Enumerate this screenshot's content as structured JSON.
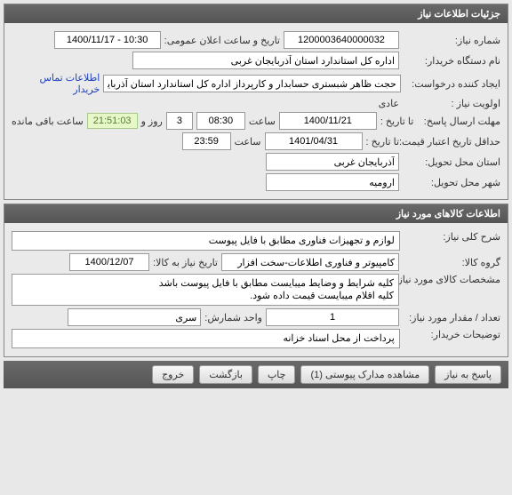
{
  "section1": {
    "title": "جزئیات اطلاعات نیاز",
    "need_number_label": "شماره نیاز:",
    "need_number": "1200003640000032",
    "announce_label": "تاریخ و ساعت اعلان عمومی:",
    "announce_value": "1400/11/17 - 10:30",
    "buyer_label": "نام دستگاه خریدار:",
    "buyer_value": "اداره کل استاندارد استان آذربایجان غربی",
    "requester_label": "ایجاد کننده درخواست:",
    "requester_value": "حجت ظاهر شبستری حسابدار و کارپرداز اداره کل استاندارد استان آذربایجان غربی",
    "contact_link": "اطلاعات تماس خریدار",
    "priority_label": "اولویت نیاز :",
    "priority_value": "عادی",
    "deadline_label": "مهلت ارسال پاسخ:",
    "to_date_label": "تا تاریخ :",
    "deadline_date": "1400/11/21",
    "time_label": "ساعت",
    "deadline_time": "08:30",
    "days_value": "3",
    "days_and": "روز و",
    "countdown": "21:51:03",
    "remaining": "ساعت باقی مانده",
    "validity_label": "حداقل تاریخ اعتبار قیمت:",
    "validity_date": "1401/04/31",
    "validity_time": "23:59",
    "province_label": "استان محل تحویل:",
    "province_value": "آذربایجان غربی",
    "city_label": "شهر محل تحویل:",
    "city_value": "ارومیه"
  },
  "section2": {
    "title": "اطلاعات کالاهای مورد نیاز",
    "desc_label": "شرح کلی نیاز:",
    "desc_value": "لوازم و تجهیزات فناوری مطابق با فایل پیوست",
    "group_label": "گروه کالا:",
    "group_value": "کامپیوتر و فناوری اطلاعات-سخت افزار",
    "need_date_label": "تاریخ نیاز به کالا:",
    "need_date_value": "1400/12/07",
    "spec_label": "مشخصات کالای مورد نیاز:",
    "spec_value": "کلیه شرایط و وضایط میبایست مطابق با فایل پیوست باشد\nکلیه اقلام میبایست قیمت داده شود.",
    "qty_label": "تعداد / مقدار مورد نیاز:",
    "qty_value": "1",
    "unit_label": "واحد شمارش:",
    "unit_value": "سری",
    "notes_label": "توضیحات خریدار:",
    "notes_value": "پرداخت از محل اسناد خزانه"
  },
  "toolbar": {
    "respond": "پاسخ به نیاز",
    "attachments": "مشاهده مدارک پیوستی (1)",
    "print": "چاپ",
    "back": "بازگشت",
    "exit": "خروج"
  }
}
